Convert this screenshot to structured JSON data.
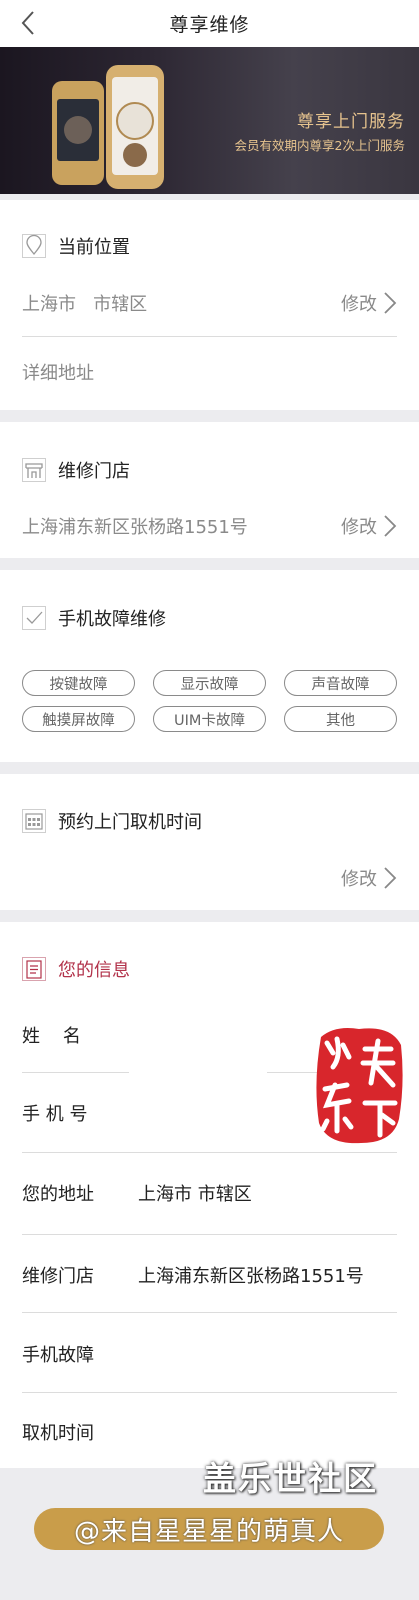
{
  "header": {
    "title": "尊享维修"
  },
  "banner": {
    "title": "尊享上门服务",
    "subtitle": "会员有效期内尊享2次上门服务"
  },
  "location": {
    "heading": "当前位置",
    "region": "上海市   市辖区",
    "edit_label": "修改",
    "detail_placeholder": "详细地址"
  },
  "store": {
    "heading": "维修门店",
    "address": "上海浦东新区张杨路1551号",
    "edit_label": "修改"
  },
  "fault": {
    "heading": "手机故障维修",
    "tags": [
      "按键故障",
      "显示故障",
      "声音故障",
      "触摸屏故障",
      "UIM卡故障",
      "其他"
    ]
  },
  "appointment": {
    "heading": "预约上门取机时间",
    "edit_label": "修改"
  },
  "info": {
    "heading": "您的信息",
    "name_label": "姓    名",
    "phone_label": "手 机 号",
    "address_label": "您的地址",
    "address_value": "上海市 市辖区",
    "store_label": "维修门店",
    "store_value": "上海浦东新区张杨路1551号",
    "fault_label": "手机故障",
    "time_label": "取机时间"
  },
  "seal": {
    "text": "心系天下"
  },
  "watermark": {
    "forum": "盖乐世社区",
    "author": "@来自星星星的萌真人"
  },
  "colors": {
    "accent_red": "#b2324a",
    "banner_gold": "#e6c38e",
    "watermark_gold": "#c6963c"
  }
}
